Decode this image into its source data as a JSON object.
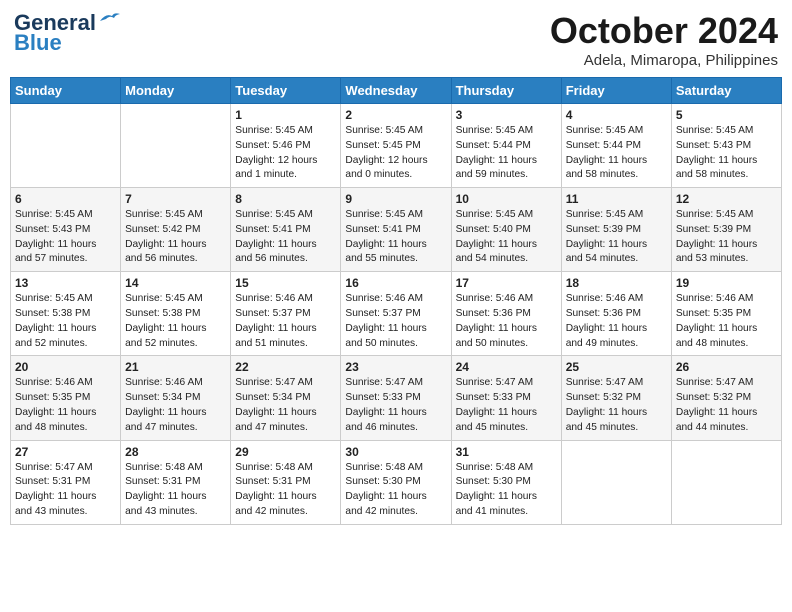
{
  "header": {
    "logo_line1": "General",
    "logo_line2": "Blue",
    "month": "October 2024",
    "location": "Adela, Mimaropa, Philippines"
  },
  "weekdays": [
    "Sunday",
    "Monday",
    "Tuesday",
    "Wednesday",
    "Thursday",
    "Friday",
    "Saturday"
  ],
  "weeks": [
    [
      {
        "day": "",
        "content": ""
      },
      {
        "day": "",
        "content": ""
      },
      {
        "day": "1",
        "content": "Sunrise: 5:45 AM\nSunset: 5:46 PM\nDaylight: 12 hours\nand 1 minute."
      },
      {
        "day": "2",
        "content": "Sunrise: 5:45 AM\nSunset: 5:45 PM\nDaylight: 12 hours\nand 0 minutes."
      },
      {
        "day": "3",
        "content": "Sunrise: 5:45 AM\nSunset: 5:44 PM\nDaylight: 11 hours\nand 59 minutes."
      },
      {
        "day": "4",
        "content": "Sunrise: 5:45 AM\nSunset: 5:44 PM\nDaylight: 11 hours\nand 58 minutes."
      },
      {
        "day": "5",
        "content": "Sunrise: 5:45 AM\nSunset: 5:43 PM\nDaylight: 11 hours\nand 58 minutes."
      }
    ],
    [
      {
        "day": "6",
        "content": "Sunrise: 5:45 AM\nSunset: 5:43 PM\nDaylight: 11 hours\nand 57 minutes."
      },
      {
        "day": "7",
        "content": "Sunrise: 5:45 AM\nSunset: 5:42 PM\nDaylight: 11 hours\nand 56 minutes."
      },
      {
        "day": "8",
        "content": "Sunrise: 5:45 AM\nSunset: 5:41 PM\nDaylight: 11 hours\nand 56 minutes."
      },
      {
        "day": "9",
        "content": "Sunrise: 5:45 AM\nSunset: 5:41 PM\nDaylight: 11 hours\nand 55 minutes."
      },
      {
        "day": "10",
        "content": "Sunrise: 5:45 AM\nSunset: 5:40 PM\nDaylight: 11 hours\nand 54 minutes."
      },
      {
        "day": "11",
        "content": "Sunrise: 5:45 AM\nSunset: 5:39 PM\nDaylight: 11 hours\nand 54 minutes."
      },
      {
        "day": "12",
        "content": "Sunrise: 5:45 AM\nSunset: 5:39 PM\nDaylight: 11 hours\nand 53 minutes."
      }
    ],
    [
      {
        "day": "13",
        "content": "Sunrise: 5:45 AM\nSunset: 5:38 PM\nDaylight: 11 hours\nand 52 minutes."
      },
      {
        "day": "14",
        "content": "Sunrise: 5:45 AM\nSunset: 5:38 PM\nDaylight: 11 hours\nand 52 minutes."
      },
      {
        "day": "15",
        "content": "Sunrise: 5:46 AM\nSunset: 5:37 PM\nDaylight: 11 hours\nand 51 minutes."
      },
      {
        "day": "16",
        "content": "Sunrise: 5:46 AM\nSunset: 5:37 PM\nDaylight: 11 hours\nand 50 minutes."
      },
      {
        "day": "17",
        "content": "Sunrise: 5:46 AM\nSunset: 5:36 PM\nDaylight: 11 hours\nand 50 minutes."
      },
      {
        "day": "18",
        "content": "Sunrise: 5:46 AM\nSunset: 5:36 PM\nDaylight: 11 hours\nand 49 minutes."
      },
      {
        "day": "19",
        "content": "Sunrise: 5:46 AM\nSunset: 5:35 PM\nDaylight: 11 hours\nand 48 minutes."
      }
    ],
    [
      {
        "day": "20",
        "content": "Sunrise: 5:46 AM\nSunset: 5:35 PM\nDaylight: 11 hours\nand 48 minutes."
      },
      {
        "day": "21",
        "content": "Sunrise: 5:46 AM\nSunset: 5:34 PM\nDaylight: 11 hours\nand 47 minutes."
      },
      {
        "day": "22",
        "content": "Sunrise: 5:47 AM\nSunset: 5:34 PM\nDaylight: 11 hours\nand 47 minutes."
      },
      {
        "day": "23",
        "content": "Sunrise: 5:47 AM\nSunset: 5:33 PM\nDaylight: 11 hours\nand 46 minutes."
      },
      {
        "day": "24",
        "content": "Sunrise: 5:47 AM\nSunset: 5:33 PM\nDaylight: 11 hours\nand 45 minutes."
      },
      {
        "day": "25",
        "content": "Sunrise: 5:47 AM\nSunset: 5:32 PM\nDaylight: 11 hours\nand 45 minutes."
      },
      {
        "day": "26",
        "content": "Sunrise: 5:47 AM\nSunset: 5:32 PM\nDaylight: 11 hours\nand 44 minutes."
      }
    ],
    [
      {
        "day": "27",
        "content": "Sunrise: 5:47 AM\nSunset: 5:31 PM\nDaylight: 11 hours\nand 43 minutes."
      },
      {
        "day": "28",
        "content": "Sunrise: 5:48 AM\nSunset: 5:31 PM\nDaylight: 11 hours\nand 43 minutes."
      },
      {
        "day": "29",
        "content": "Sunrise: 5:48 AM\nSunset: 5:31 PM\nDaylight: 11 hours\nand 42 minutes."
      },
      {
        "day": "30",
        "content": "Sunrise: 5:48 AM\nSunset: 5:30 PM\nDaylight: 11 hours\nand 42 minutes."
      },
      {
        "day": "31",
        "content": "Sunrise: 5:48 AM\nSunset: 5:30 PM\nDaylight: 11 hours\nand 41 minutes."
      },
      {
        "day": "",
        "content": ""
      },
      {
        "day": "",
        "content": ""
      }
    ]
  ]
}
